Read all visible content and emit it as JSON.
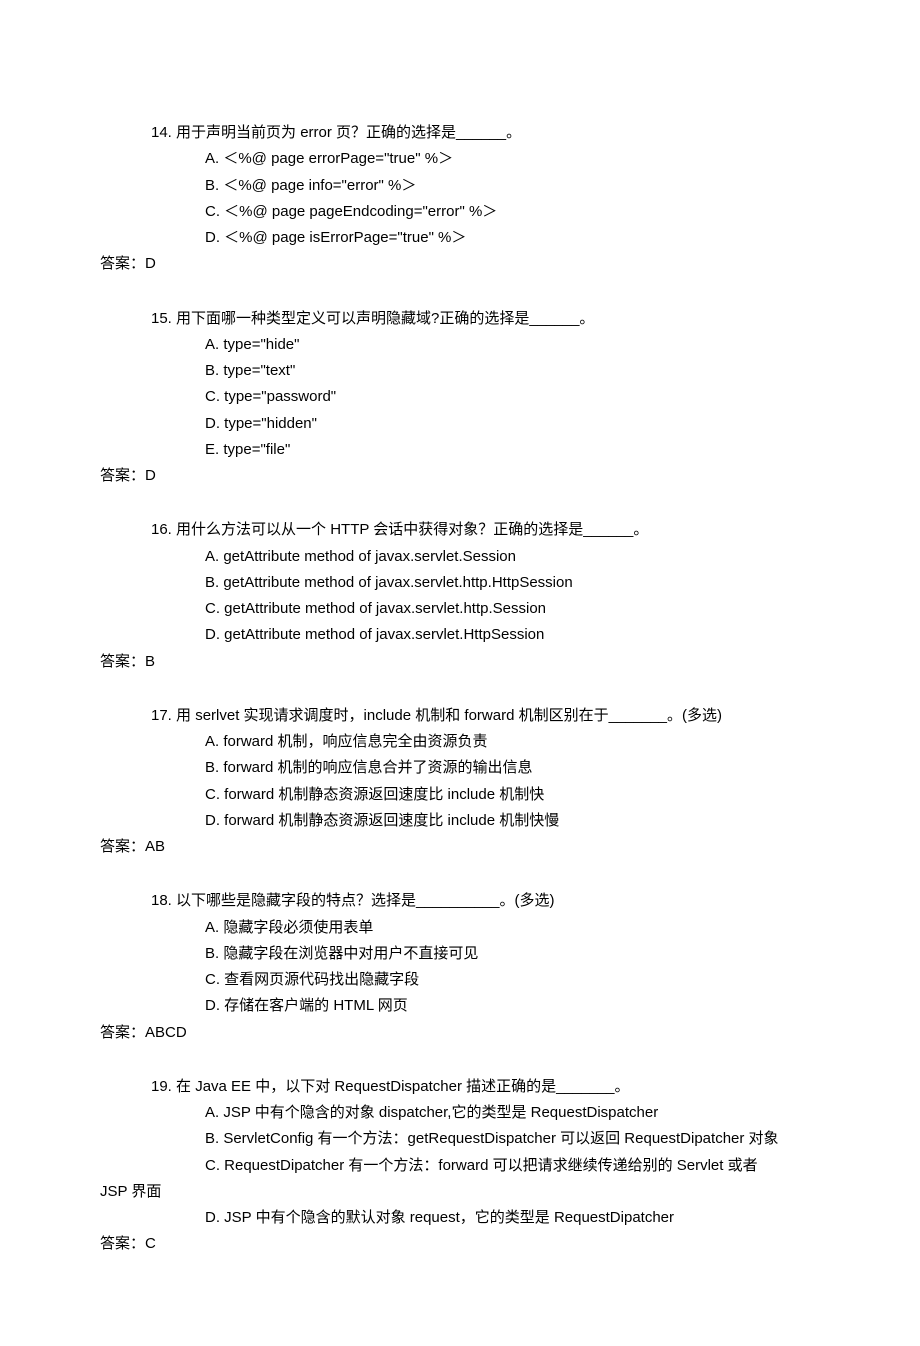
{
  "questions": [
    {
      "num": "14.",
      "stem": "用于声明当前页为 error 页？正确的选择是______。",
      "options": [
        "A. ＜%@ page errorPage=\"true\" %＞",
        "B. ＜%@ page info=\"error\" %＞",
        "C. ＜%@ page pageEndcoding=\"error\" %＞",
        "D. ＜%@ page isErrorPage=\"true\" %＞"
      ],
      "answer": "答案：D"
    },
    {
      "num": "15.",
      "stem": "用下面哪一种类型定义可以声明隐藏域?正确的选择是______。",
      "options": [
        "A. type=\"hide\"",
        "B. type=\"text\"",
        "C. type=\"password\"",
        "D. type=\"hidden\"",
        "E. type=\"file\""
      ],
      "answer": "答案：D"
    },
    {
      "num": "16.",
      "stem": "用什么方法可以从一个 HTTP 会话中获得对象？正确的选择是______。",
      "options": [
        "A. getAttribute method of javax.servlet.Session",
        "B. getAttribute method of javax.servlet.http.HttpSession",
        "C. getAttribute method of javax.servlet.http.Session",
        "D. getAttribute method of javax.servlet.HttpSession"
      ],
      "answer": "答案：B"
    },
    {
      "num": "17.",
      "stem": "用 serlvet 实现请求调度时，include 机制和 forward 机制区别在于_______。(多选)",
      "options": [
        "A. forward 机制，响应信息完全由资源负责",
        "B. forward 机制的响应信息合并了资源的输出信息",
        "C. forward 机制静态资源返回速度比 include 机制快",
        "D. forward 机制静态资源返回速度比 include 机制快慢"
      ],
      "answer": "答案：AB"
    },
    {
      "num": "18.",
      "stem": "以下哪些是隐藏字段的特点？选择是__________。(多选)",
      "options": [
        "A. 隐藏字段必须使用表单",
        "B. 隐藏字段在浏览器中对用户不直接可见",
        "C. 查看网页源代码找出隐藏字段",
        "D. 存储在客户端的 HTML 网页"
      ],
      "answer": "答案：ABCD"
    },
    {
      "num": "19.",
      "stem": "在 Java EE 中，以下对 RequestDispatcher 描述正确的是_______。",
      "optionsA": "A. JSP 中有个隐含的对象 dispatcher,它的类型是 RequestDispatcher",
      "optionsB": "B. ServletConfig 有一个方法：getRequestDispatcher 可以返回 RequestDipatcher 对象",
      "optionsC": "C. RequestDipatcher  有一个方法：forward 可以把请求继续传递给别的 Servlet 或者",
      "optionsC2": "JSP 界面",
      "optionsD": "D. JSP 中有个隐含的默认对象 request，它的类型是 RequestDipatcher",
      "answer": "答案：C"
    }
  ]
}
